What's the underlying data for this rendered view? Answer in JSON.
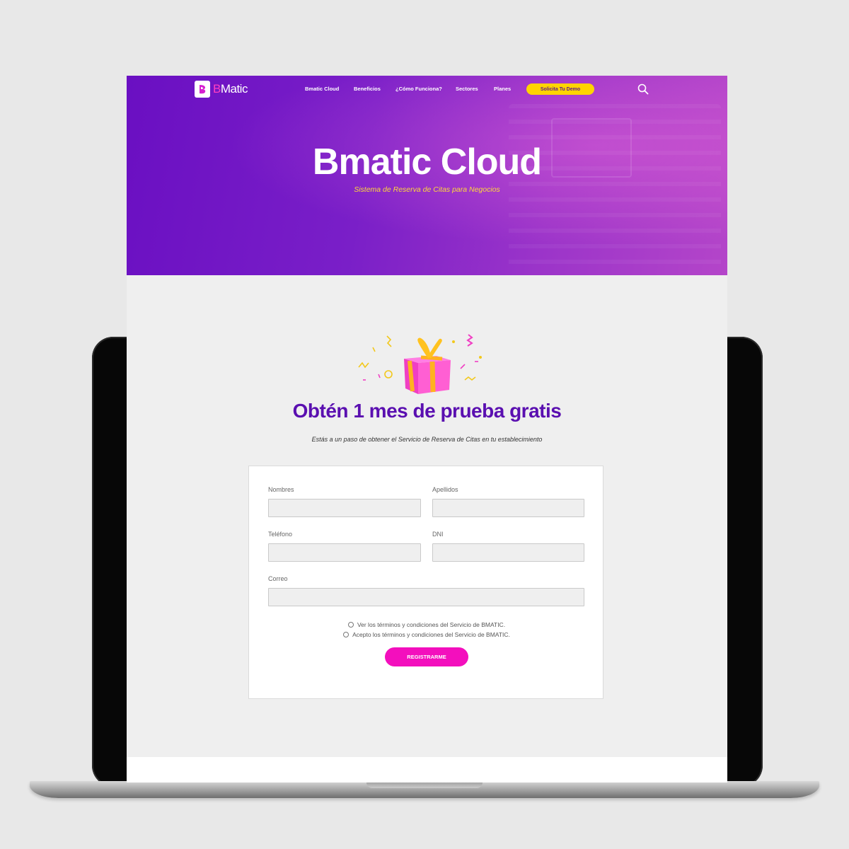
{
  "nav": {
    "logo_b": "B",
    "logo_rest": "Matic",
    "items": [
      "Bmatic Cloud",
      "Beneficios",
      "¿Cómo Funciona?",
      "Sectores",
      "Planes"
    ],
    "demo_label": "Solicita Tu Demo"
  },
  "hero": {
    "title": "Bmatic Cloud",
    "subtitle": "Sistema de Reserva de Citas para Negocios"
  },
  "offer": {
    "title": "Obtén 1 mes de prueba gratis",
    "subtitle": "Estás a un paso de obtener el Servicio de Reserva de Citas en tu establecimiento"
  },
  "form": {
    "fields": {
      "nombres": {
        "label": "Nombres",
        "value": ""
      },
      "apellidos": {
        "label": "Apellidos",
        "value": ""
      },
      "telefono": {
        "label": "Teléfono",
        "value": ""
      },
      "dni": {
        "label": "DNI",
        "value": ""
      },
      "correo": {
        "label": "Correo",
        "value": ""
      }
    },
    "checks": [
      "Ver los términos y condiciones del Servicio de BMATIC.",
      "Acepto los términos y condiciones del Servicio de BMATIC."
    ],
    "submit_label": "REGISTRARME"
  },
  "colors": {
    "brand_purple": "#6a0fc2",
    "accent_pink": "#f30fbd",
    "accent_yellow": "#ffd400"
  },
  "icons": {
    "search": "search-icon",
    "gift": "gift-icon",
    "logo": "bmatic-logo-icon"
  }
}
